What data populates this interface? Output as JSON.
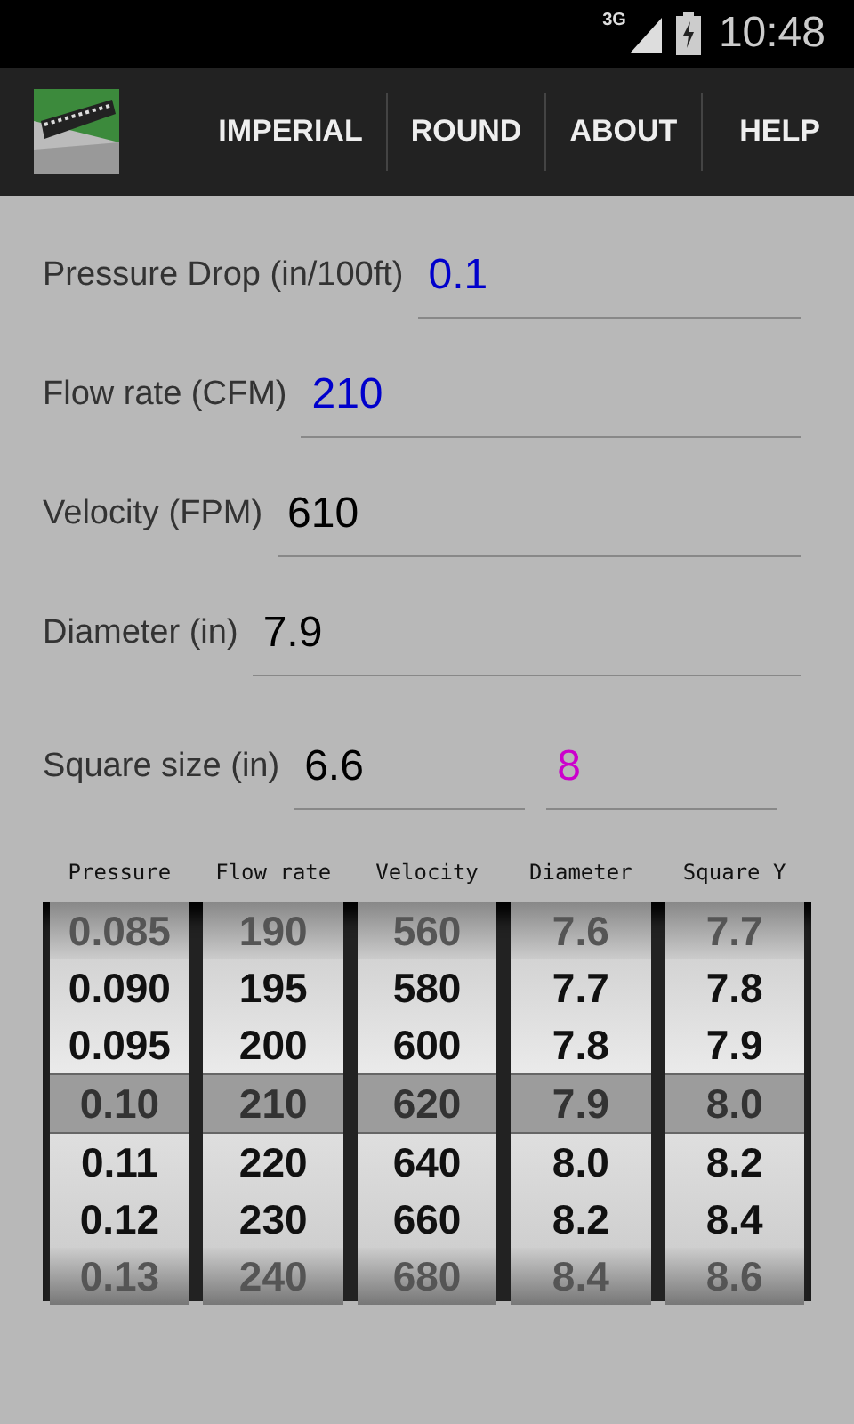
{
  "status_bar": {
    "network": "3G",
    "time": "10:48"
  },
  "action_bar": {
    "items": [
      "IMPERIAL",
      "ROUND",
      "ABOUT",
      "HELP"
    ]
  },
  "fields": [
    {
      "label": "Pressure Drop (in/100ft)",
      "values": [
        {
          "text": "0.1",
          "color": "#0000cc"
        }
      ]
    },
    {
      "label": "Flow rate (CFM)",
      "values": [
        {
          "text": "210",
          "color": "#0000cc"
        }
      ]
    },
    {
      "label": "Velocity (FPM)",
      "values": [
        {
          "text": "610",
          "color": "#000000"
        }
      ]
    },
    {
      "label": "Diameter (in)",
      "values": [
        {
          "text": "7.9",
          "color": "#000000"
        }
      ]
    },
    {
      "label": "Square size (in)",
      "values": [
        {
          "text": "6.6",
          "color": "#000000"
        },
        {
          "text": "8",
          "color": "#cc00cc"
        }
      ]
    }
  ],
  "wheels": [
    {
      "heading": "Pressure",
      "values": [
        {
          "text": "0.085",
          "selected": false
        },
        {
          "text": "0.090",
          "selected": false
        },
        {
          "text": "0.095",
          "selected": false
        },
        {
          "text": "0.10",
          "selected": true
        },
        {
          "text": "0.11",
          "selected": false
        },
        {
          "text": "0.12",
          "selected": false
        },
        {
          "text": "0.13",
          "selected": false
        }
      ]
    },
    {
      "heading": "Flow rate",
      "values": [
        {
          "text": "190",
          "selected": false
        },
        {
          "text": "195",
          "selected": false
        },
        {
          "text": "200",
          "selected": false
        },
        {
          "text": "210",
          "selected": true
        },
        {
          "text": "220",
          "selected": false
        },
        {
          "text": "230",
          "selected": false
        },
        {
          "text": "240",
          "selected": false
        }
      ]
    },
    {
      "heading": "Velocity",
      "values": [
        {
          "text": "560",
          "selected": false
        },
        {
          "text": "580",
          "selected": false
        },
        {
          "text": "600",
          "selected": false
        },
        {
          "text": "620",
          "selected": true
        },
        {
          "text": "640",
          "selected": false
        },
        {
          "text": "660",
          "selected": false
        },
        {
          "text": "680",
          "selected": false
        }
      ]
    },
    {
      "heading": "Diameter",
      "values": [
        {
          "text": "7.6",
          "selected": false
        },
        {
          "text": "7.7",
          "selected": false
        },
        {
          "text": "7.8",
          "selected": false
        },
        {
          "text": "7.9",
          "selected": true
        },
        {
          "text": "8.0",
          "selected": false
        },
        {
          "text": "8.2",
          "selected": false
        },
        {
          "text": "8.4",
          "selected": false
        }
      ]
    },
    {
      "heading": "Square Y",
      "values": [
        {
          "text": "7.7",
          "selected": false
        },
        {
          "text": "7.8",
          "selected": false
        },
        {
          "text": "7.9",
          "selected": false
        },
        {
          "text": "8.0",
          "selected": true
        },
        {
          "text": "8.2",
          "selected": false
        },
        {
          "text": "8.4",
          "selected": false
        },
        {
          "text": "8.6",
          "selected": false
        }
      ]
    }
  ]
}
